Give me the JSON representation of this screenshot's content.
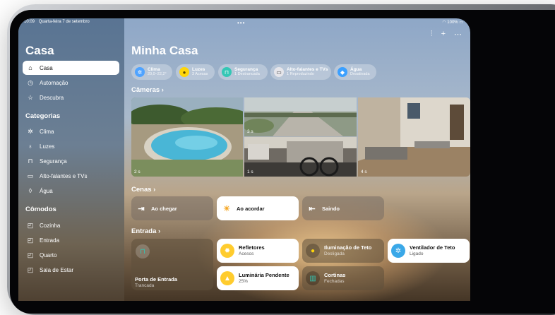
{
  "status": {
    "time": "10:09",
    "date": "Quarta-feira 7 de setembro",
    "battery": "100%"
  },
  "sidebar": {
    "title": "Casa",
    "nav": [
      {
        "label": "Casa",
        "icon": "house-icon",
        "active": true
      },
      {
        "label": "Automação",
        "icon": "clock-check-icon"
      },
      {
        "label": "Descubra",
        "icon": "star-icon"
      }
    ],
    "categories_heading": "Categorias",
    "categories": [
      {
        "label": "Clima",
        "icon": "fan-icon"
      },
      {
        "label": "Luzes",
        "icon": "lightbulb-icon"
      },
      {
        "label": "Segurança",
        "icon": "lock-icon"
      },
      {
        "label": "Alto-falantes e TVs",
        "icon": "tv-speaker-icon"
      },
      {
        "label": "Água",
        "icon": "drop-icon"
      }
    ],
    "rooms_heading": "Cômodos",
    "rooms": [
      {
        "label": "Cozinha",
        "icon": "room-icon"
      },
      {
        "label": "Entrada",
        "icon": "room-icon"
      },
      {
        "label": "Quarto",
        "icon": "room-icon"
      },
      {
        "label": "Sala de Estar",
        "icon": "room-icon"
      }
    ]
  },
  "main": {
    "title": "Minha Casa",
    "pills": [
      {
        "title": "Clima",
        "subtitle": "20,0–22,2°",
        "icon": "fan-icon",
        "color": "#4fa3ff"
      },
      {
        "title": "Luzes",
        "subtitle": "3 Acesas",
        "icon": "lightbulb-icon",
        "color": "#ffd60a"
      },
      {
        "title": "Segurança",
        "subtitle": "1 Destrancada",
        "icon": "lock-icon",
        "color": "#34c7b5"
      },
      {
        "title": "Alto-falantes e TVs",
        "subtitle": "1 Reproduzindo",
        "icon": "tv-speaker-icon",
        "color": "#e5e5ea"
      },
      {
        "title": "Água",
        "subtitle": "Desativada",
        "icon": "drop-icon",
        "color": "#3ba0ff"
      }
    ],
    "cameras_heading": "Câmeras",
    "cameras": [
      {
        "timestamp": "2 s"
      },
      {
        "timestamp": "3 s"
      },
      {
        "timestamp": "1 s"
      },
      {
        "timestamp": "4 s"
      }
    ],
    "scenes_heading": "Cenas",
    "scenes": [
      {
        "label": "Ao chegar",
        "icon": "walk-in-icon",
        "active": false
      },
      {
        "label": "Ao acordar",
        "icon": "sunrise-icon",
        "active": true
      },
      {
        "label": "Saindo",
        "icon": "walk-out-icon",
        "active": false
      }
    ],
    "room_heading": "Entrada",
    "accessories": [
      {
        "name": "Porta de Entrada",
        "state": "Trancada",
        "icon": "lock-icon",
        "on": false
      },
      {
        "name": "Refletores",
        "state": "Acesos",
        "icon": "floodlight-icon",
        "on": true
      },
      {
        "name": "Iluminação de Teto",
        "state": "Desligada",
        "icon": "lightbulb-icon",
        "on": false
      },
      {
        "name": "Ventilador de Teto",
        "state": "Ligado",
        "icon": "fan-icon",
        "on": true
      },
      {
        "name": "Luminária Pendente",
        "state": "25%",
        "icon": "pendant-lamp-icon",
        "on": true
      },
      {
        "name": "Cortinas",
        "state": "Fechadas",
        "icon": "curtains-icon",
        "on": false
      }
    ]
  }
}
